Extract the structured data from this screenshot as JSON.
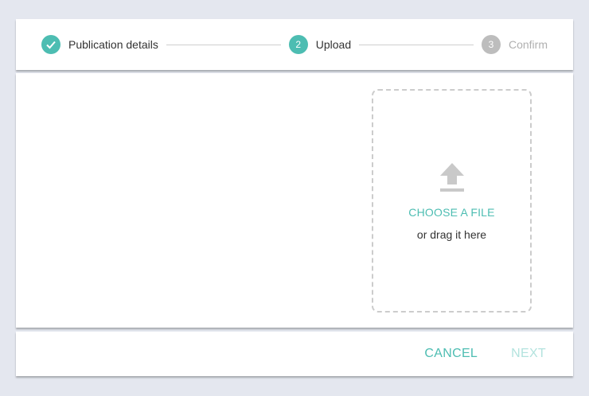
{
  "stepper": {
    "steps": [
      {
        "number": "",
        "label": "Publication details",
        "state": "done"
      },
      {
        "number": "2",
        "label": "Upload",
        "state": "active"
      },
      {
        "number": "3",
        "label": "Confirm",
        "state": "pending"
      }
    ]
  },
  "upload": {
    "icon": "upload-icon",
    "choose_label": "CHOOSE A FILE",
    "drag_label": "or drag it here"
  },
  "actions": {
    "cancel_label": "CANCEL",
    "next_label": "NEXT"
  },
  "colors": {
    "accent": "#4dbdb2",
    "pending": "#bdbdbd",
    "next_disabled": "#b3e3de",
    "background": "#e4e7ef"
  }
}
